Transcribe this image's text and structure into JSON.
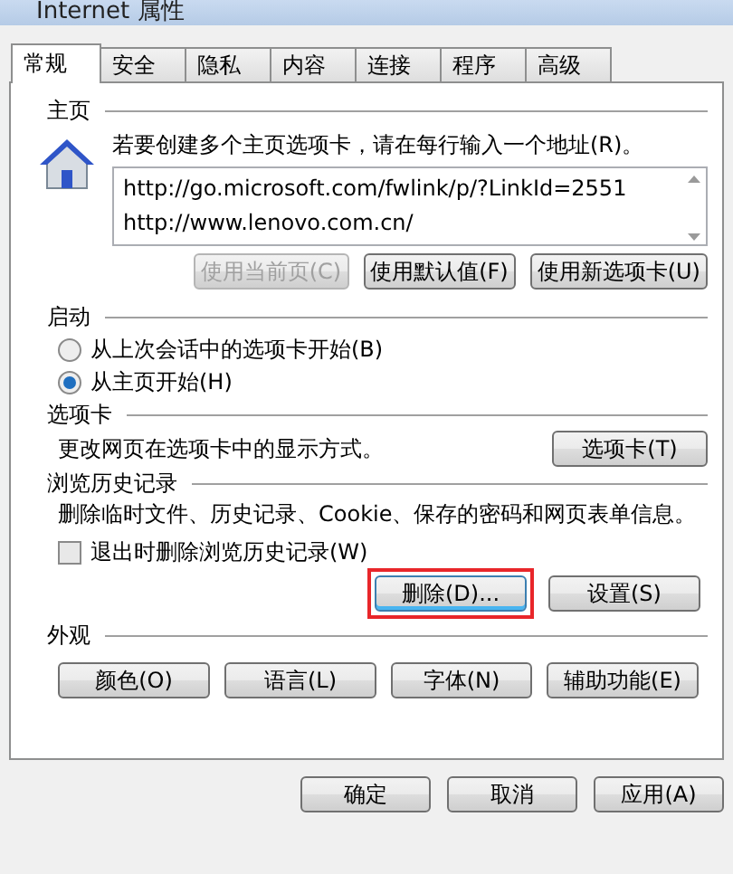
{
  "window": {
    "title": "Internet 属性"
  },
  "tabs": [
    {
      "label": "常规",
      "selected": true
    },
    {
      "label": "安全",
      "selected": false
    },
    {
      "label": "隐私",
      "selected": false
    },
    {
      "label": "内容",
      "selected": false
    },
    {
      "label": "连接",
      "selected": false
    },
    {
      "label": "程序",
      "selected": false
    },
    {
      "label": "高级",
      "selected": false
    }
  ],
  "home_page": {
    "heading": "主页",
    "description": "若要创建多个主页选项卡，请在每行输入一个地址(R)。",
    "urls": [
      "http://go.microsoft.com/fwlink/p/?LinkId=2551",
      "http://www.lenovo.com.cn/"
    ],
    "buttons": [
      {
        "label": "使用当前页(C)",
        "disabled": true
      },
      {
        "label": "使用默认值(F)",
        "disabled": false
      },
      {
        "label": "使用新选项卡(U)",
        "disabled": false
      }
    ]
  },
  "startup": {
    "heading": "启动",
    "options": [
      {
        "label": "从上次会话中的选项卡开始(B)",
        "selected": false
      },
      {
        "label": "从主页开始(H)",
        "selected": true
      }
    ]
  },
  "tabs_section": {
    "heading": "选项卡",
    "description": "更改网页在选项卡中的显示方式。",
    "button": "选项卡(T)"
  },
  "history": {
    "heading": "浏览历史记录",
    "description": "删除临时文件、历史记录、Cookie、保存的密码和网页表单信息。",
    "checkbox": {
      "label": "退出时删除浏览历史记录(W)",
      "checked": false
    },
    "buttons": [
      {
        "label": "删除(D)...",
        "highlighted": true
      },
      {
        "label": "设置(S)",
        "highlighted": false
      }
    ]
  },
  "appearance": {
    "heading": "外观",
    "buttons": [
      "颜色(O)",
      "语言(L)",
      "字体(N)",
      "辅助功能(E)"
    ]
  },
  "dialog_buttons": [
    "确定",
    "取消",
    "应用(A)"
  ]
}
